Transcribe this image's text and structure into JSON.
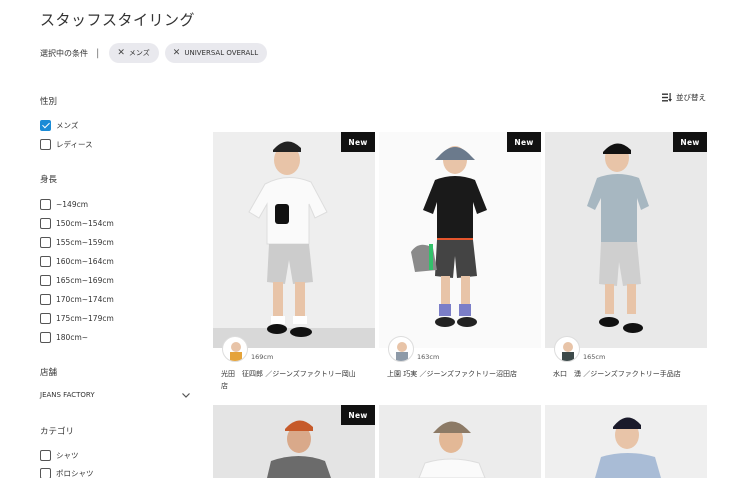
{
  "page": {
    "title": "スタッフスタイリング"
  },
  "conditions": {
    "label": "選択中の条件",
    "separator": "|",
    "chips": [
      "メンズ",
      "UNIVERSAL OVERALL"
    ]
  },
  "sort": {
    "label": "並び替え",
    "icon": "sort-icon"
  },
  "sidebar": {
    "gender": {
      "title": "性別",
      "options": [
        {
          "label": "メンズ",
          "checked": true
        },
        {
          "label": "レディース",
          "checked": false
        }
      ]
    },
    "height": {
      "title": "身長",
      "options": [
        {
          "label": "~149cm"
        },
        {
          "label": "150cm~154cm"
        },
        {
          "label": "155cm~159cm"
        },
        {
          "label": "160cm~164cm"
        },
        {
          "label": "165cm~169cm"
        },
        {
          "label": "170cm~174cm"
        },
        {
          "label": "175cm~179cm"
        },
        {
          "label": "180cm~"
        }
      ]
    },
    "store": {
      "title": "店舗",
      "selected": "JEANS FACTORY",
      "icon": "chevron-down-icon"
    },
    "category": {
      "title": "カテゴリ",
      "options": [
        {
          "label": "シャツ"
        },
        {
          "label": "ポロシャツ"
        }
      ]
    }
  },
  "cards": [
    {
      "badge": "New",
      "height": "169cm",
      "name_line1": "光田　征四郎 ／ジーンズファクトリー岡山",
      "name_line2": "店"
    },
    {
      "badge": "New",
      "height": "163cm",
      "name_line1": "上園 巧実 ／ジーンズファクトリー沼田店",
      "name_line2": ""
    },
    {
      "badge": "New",
      "height": "165cm",
      "name_line1": "水口　湧 ／ジーンズファクトリー手品店",
      "name_line2": ""
    },
    {
      "badge": "New"
    },
    {},
    {}
  ],
  "colors": {
    "accent": "#1a8bd6",
    "badge_bg": "#111111",
    "chip_bg": "#e9e9ee"
  }
}
